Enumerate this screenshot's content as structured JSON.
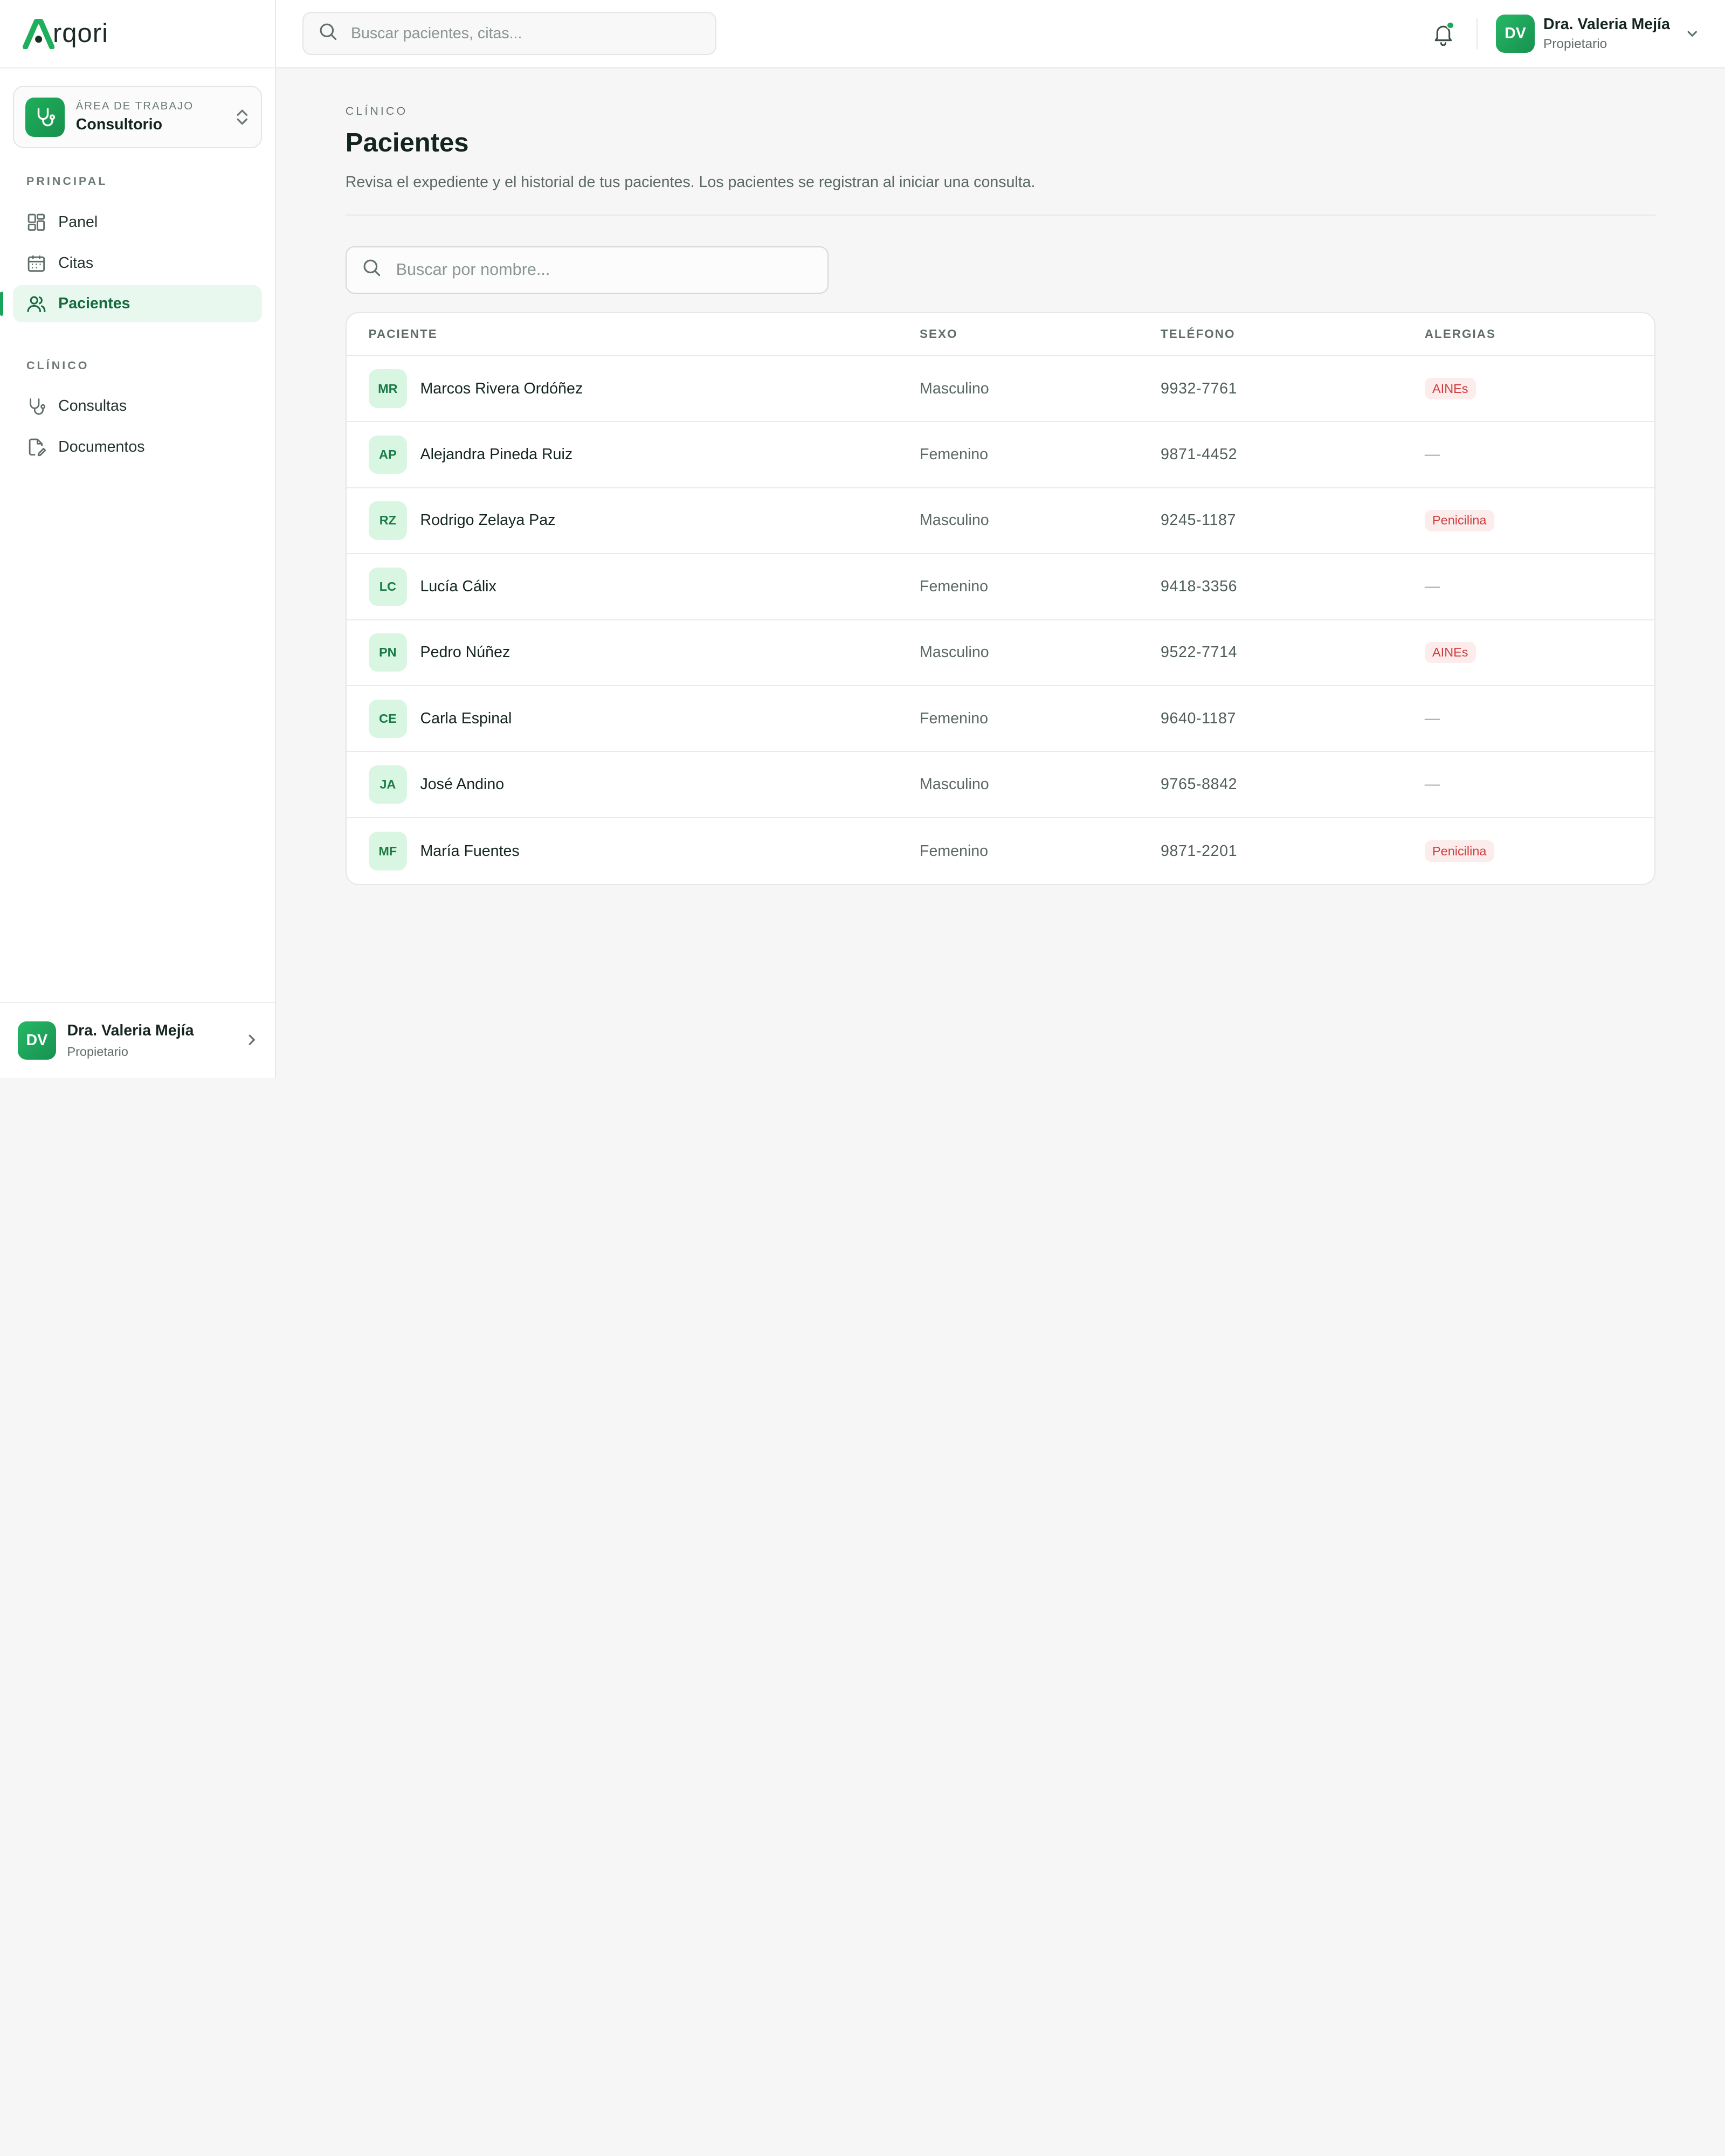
{
  "brand": {
    "logo_text": "rqori",
    "accent": "#1fae5c"
  },
  "workspace": {
    "label": "ÁREA DE TRABAJO",
    "name": "Consultorio",
    "icon": "stethoscope-icon"
  },
  "sidebar": {
    "sections": [
      {
        "label": "PRINCIPAL",
        "items": [
          {
            "label": "Panel",
            "icon": "grid-icon",
            "active": false
          },
          {
            "label": "Citas",
            "icon": "calendar-icon",
            "active": false
          },
          {
            "label": "Pacientes",
            "icon": "users-icon",
            "active": true
          }
        ]
      },
      {
        "label": "CLÍNICO",
        "items": [
          {
            "label": "Consultas",
            "icon": "stethoscope-icon",
            "active": false
          },
          {
            "label": "Documentos",
            "icon": "document-edit-icon",
            "active": false
          }
        ]
      }
    ],
    "footer": {
      "initials": "DV",
      "name": "Dra. Valeria Mejía",
      "role": "Propietario"
    }
  },
  "topbar": {
    "search_placeholder": "Buscar pacientes, citas...",
    "user": {
      "initials": "DV",
      "name": "Dra. Valeria Mejía",
      "role": "Propietario"
    }
  },
  "page": {
    "kicker": "CLÍNICO",
    "title": "Pacientes",
    "description": "Revisa el expediente y el historial de tus pacientes. Los pacientes se registran al iniciar una consulta.",
    "filter_placeholder": "Buscar por nombre..."
  },
  "table": {
    "headers": {
      "patient": "PACIENTE",
      "sex": "SEXO",
      "phone": "TELÉFONO",
      "allergies": "ALERGIAS"
    },
    "rows": [
      {
        "initials": "MR",
        "name": "Marcos Rivera Ordóñez",
        "sex": "Masculino",
        "phone": "9932-7761",
        "allergy": "AINEs"
      },
      {
        "initials": "AP",
        "name": "Alejandra Pineda Ruiz",
        "sex": "Femenino",
        "phone": "9871-4452",
        "allergy": "—"
      },
      {
        "initials": "RZ",
        "name": "Rodrigo Zelaya Paz",
        "sex": "Masculino",
        "phone": "9245-1187",
        "allergy": "Penicilina"
      },
      {
        "initials": "LC",
        "name": "Lucía Cálix",
        "sex": "Femenino",
        "phone": "9418-3356",
        "allergy": "—"
      },
      {
        "initials": "PN",
        "name": "Pedro Núñez",
        "sex": "Masculino",
        "phone": "9522-7714",
        "allergy": "AINEs"
      },
      {
        "initials": "CE",
        "name": "Carla Espinal",
        "sex": "Femenino",
        "phone": "9640-1187",
        "allergy": "—"
      },
      {
        "initials": "JA",
        "name": "José Andino",
        "sex": "Masculino",
        "phone": "9765-8842",
        "allergy": "—"
      },
      {
        "initials": "MF",
        "name": "María Fuentes",
        "sex": "Femenino",
        "phone": "9871-2201",
        "allergy": "Penicilina"
      }
    ]
  }
}
